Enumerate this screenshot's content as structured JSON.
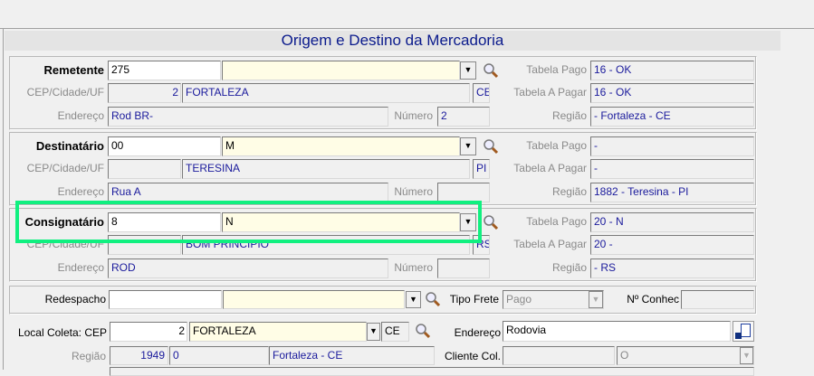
{
  "title": "Origem e Destino da Mercadoria",
  "remetente": {
    "label": "Remetente",
    "code": "275",
    "name": "",
    "cep_label": "CEP/Cidade/UF",
    "cep": "2",
    "city": "FORTALEZA",
    "uf": "CE",
    "end_label": "Endereço",
    "endereco": "Rod BR-",
    "num_label": "Número",
    "numero": "2",
    "tp_label": "Tabela Pago",
    "tabela_pago": "16 - OK",
    "tap_label": "Tabela A Pagar",
    "tabela_a_pagar": "16 - OK",
    "reg_label": "Região",
    "regiao": "- Fortaleza - CE"
  },
  "destinatario": {
    "label": "Destinatário",
    "code": "00",
    "name": "M",
    "cep_label": "CEP/Cidade/UF",
    "cep": "",
    "city": "TERESINA",
    "uf": "PI",
    "end_label": "Endereço",
    "endereco": "Rua A",
    "num_label": "Número",
    "numero": "",
    "tp_label": "Tabela Pago",
    "tabela_pago": "-",
    "tap_label": "Tabela A Pagar",
    "tabela_a_pagar": "-",
    "reg_label": "Região",
    "regiao": "1882 - Teresina - PI"
  },
  "consignatario": {
    "label": "Consignatário",
    "code": "8",
    "name": "N",
    "cep_label": "CEP/Cidade/UF",
    "cep": "",
    "city": "BOM PRINCIPIO",
    "uf": "RS",
    "end_label": "Endereço",
    "endereco": "ROD",
    "num_label": "Número",
    "numero": "",
    "tp_label": "Tabela Pago",
    "tabela_pago": "20 - N",
    "tap_label": "Tabela A Pagar",
    "tabela_a_pagar": "20 -",
    "reg_label": "Região",
    "regiao": "- RS"
  },
  "redespacho": {
    "label": "Redespacho",
    "code": "",
    "name": "",
    "tipo_frete_label": "Tipo Frete",
    "tipo_frete": "Pago",
    "conhec_label": "Nº Conhec",
    "conhec": ""
  },
  "coleta": {
    "label": "Local Coleta: CEP",
    "cep": "2",
    "city": "FORTALEZA",
    "uf": "CE",
    "end_label": "Endereço",
    "endereco": "Rodovia",
    "reg_label": "Região",
    "reg_code": "1949",
    "reg_mid": "0",
    "reg_name": "Fortaleza - CE",
    "cliente_label": "Cliente Col.",
    "cliente": "",
    "cliente_sel": "O"
  }
}
